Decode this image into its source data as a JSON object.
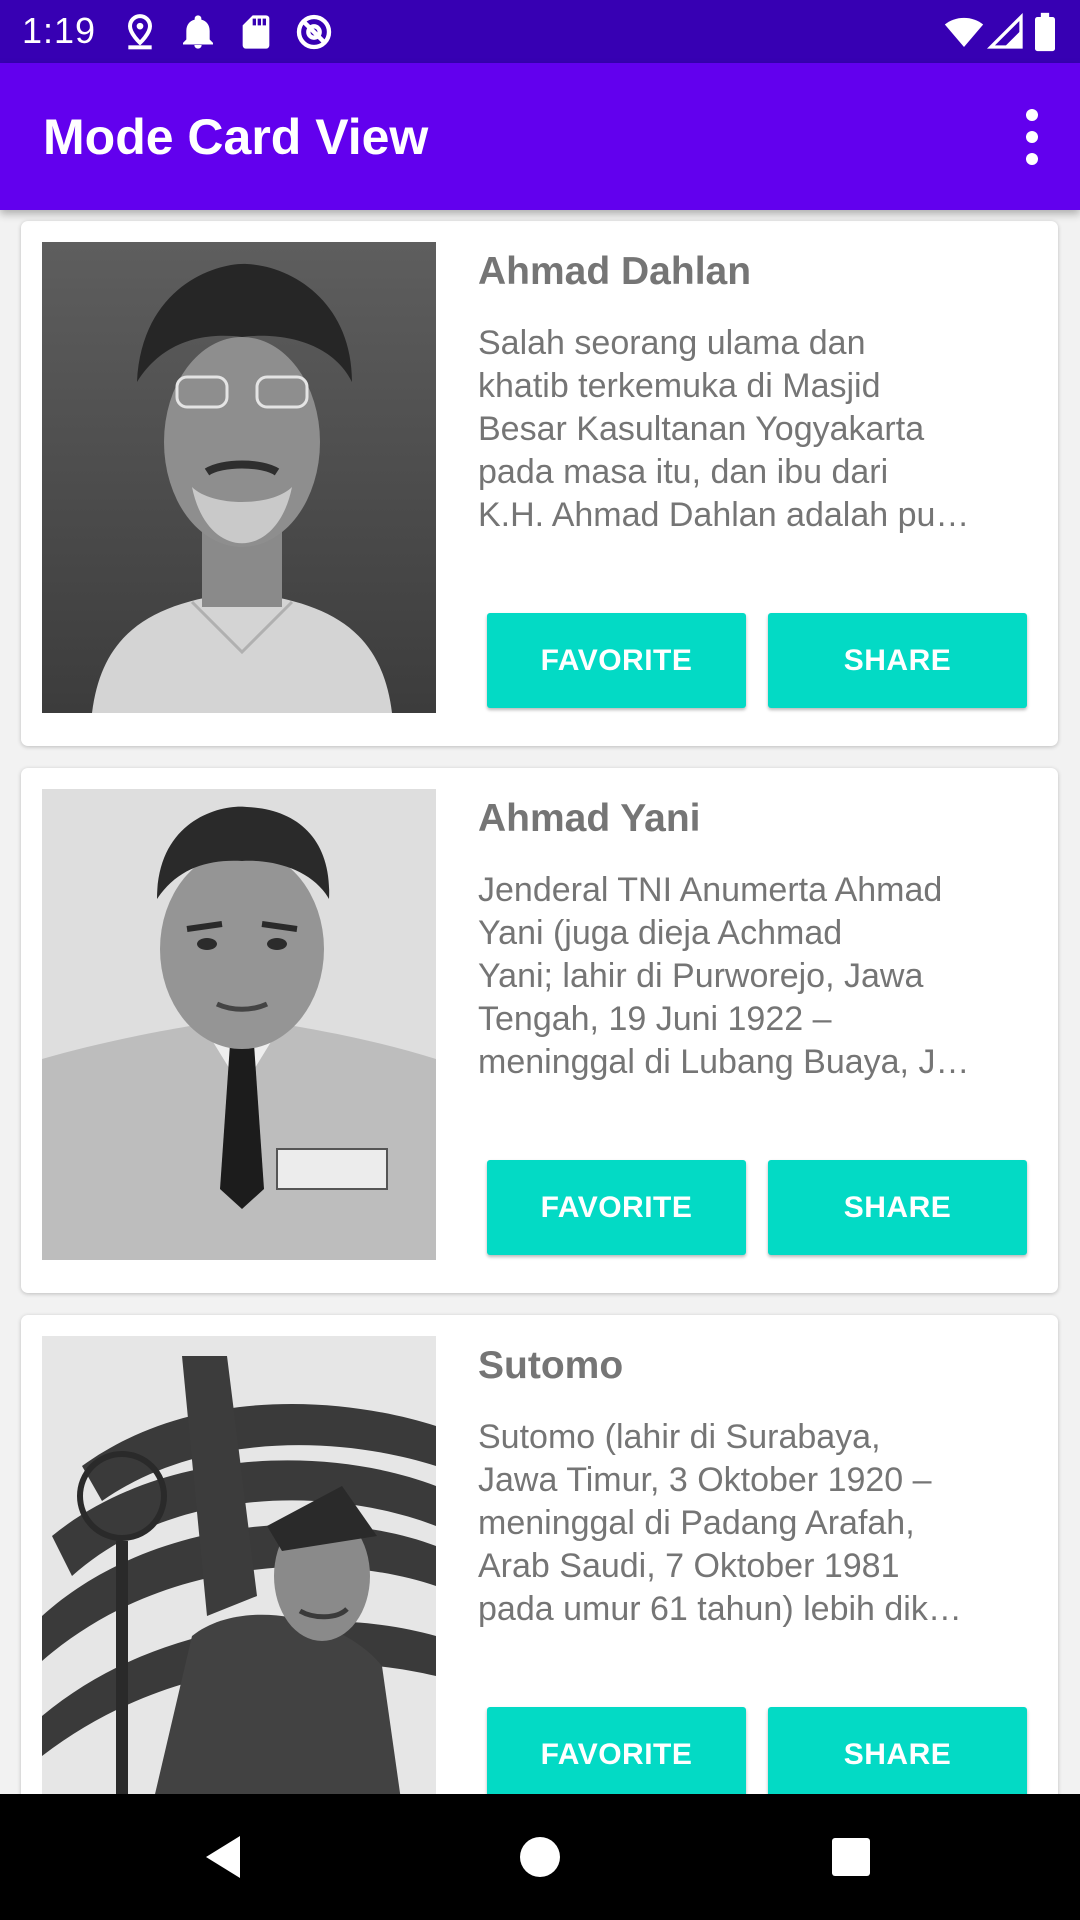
{
  "status_bar": {
    "time": "1:19",
    "left_icons": [
      "location-icon",
      "notification-bell-icon",
      "sd-card-icon",
      "at-sign-icon"
    ],
    "right_icons": [
      "wifi-icon",
      "cell-signal-icon",
      "battery-icon"
    ]
  },
  "app_bar": {
    "title": "Mode Card View",
    "menu_icon": "more-vert-icon"
  },
  "cards": [
    {
      "name": "Ahmad Dahlan",
      "description_lines": [
        "Salah seorang ulama dan",
        "khatib terkemuka di Masjid",
        "Besar Kasultanan Yogyakarta",
        "pada masa itu, dan ibu dari",
        "K.H. Ahmad Dahlan adalah pu…"
      ],
      "favorite_label": "FAVORITE",
      "share_label": "SHARE"
    },
    {
      "name": "Ahmad Yani",
      "description_lines": [
        "Jenderal TNI Anumerta Ahmad",
        "Yani (juga dieja Achmad",
        "Yani; lahir di Purworejo, Jawa",
        "Tengah, 19 Juni 1922 –",
        "meninggal di Lubang Buaya, J…"
      ],
      "favorite_label": "FAVORITE",
      "share_label": "SHARE"
    },
    {
      "name": "Sutomo",
      "description_lines": [
        "Sutomo (lahir di Surabaya,",
        "Jawa Timur, 3 Oktober 1920 –",
        "meninggal di Padang Arafah,",
        "Arab Saudi, 7 Oktober 1981",
        "pada umur 61 tahun) lebih dik…"
      ],
      "favorite_label": "FAVORITE",
      "share_label": "SHARE"
    }
  ],
  "nav_bar": {
    "icons": [
      "back-icon",
      "home-icon",
      "recents-icon"
    ]
  },
  "colors": {
    "status_bar": "#3700b3",
    "app_bar": "#6200ee",
    "button": "#03dac5",
    "text_secondary": "#757575"
  }
}
